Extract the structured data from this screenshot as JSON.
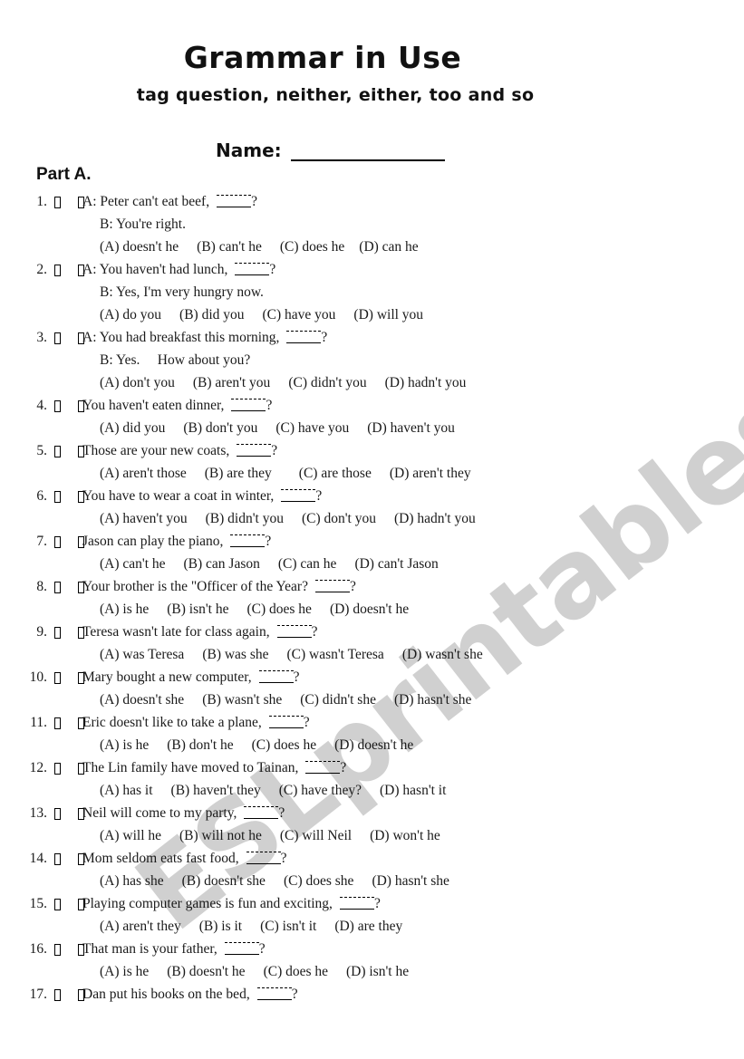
{
  "header": {
    "title": "Grammar in Use",
    "subtitle": "tag question, neither, either, too and so",
    "name_label": "Name:"
  },
  "part_label": "Part A.",
  "watermark": "ESLprintables.com",
  "questions": [
    {
      "num": "1.",
      "stem": "A: Peter can't eat beef,",
      "sub": "B: You're right.",
      "options": [
        "(A) doesn't he",
        "(B) can't he",
        "(C) does he",
        "(D) can he"
      ]
    },
    {
      "num": "2.",
      "stem": "A: You haven't had lunch,",
      "sub": "B: Yes, I'm very hungry now.",
      "options": [
        "(A) do you",
        "(B) did you",
        "(C) have you",
        "(D) will you"
      ]
    },
    {
      "num": "3.",
      "stem": "A: You had breakfast this morning,",
      "sub": "B: Yes.     How about you?",
      "options": [
        "(A) don't you",
        "(B) aren't you",
        "(C) didn't you",
        "(D) hadn't you"
      ]
    },
    {
      "num": "4.",
      "stem": "You haven't eaten dinner,",
      "options": [
        "(A) did you",
        "(B) don't you",
        "(C) have you",
        "(D) haven't you"
      ]
    },
    {
      "num": "5.",
      "stem": "Those are your new coats,",
      "options": [
        "(A) aren't those",
        "(B) are they",
        "(C) are those",
        "(D) aren't they"
      ]
    },
    {
      "num": "6.",
      "stem": "You have to wear a coat in winter,",
      "options": [
        "(A) haven't you",
        "(B) didn't you",
        "(C) don't you",
        "(D) hadn't you"
      ]
    },
    {
      "num": "7.",
      "stem": "Jason can play the piano,",
      "options": [
        "(A) can't he",
        "(B) can Jason",
        "(C) can he",
        "(D) can't Jason"
      ]
    },
    {
      "num": "8.",
      "stem": "Your brother is the \"Officer of the Year?",
      "options": [
        "(A) is he",
        "(B) isn't he",
        "(C) does he",
        "(D) doesn't he"
      ]
    },
    {
      "num": "9.",
      "stem": "Teresa wasn't late for class again,",
      "options": [
        "(A) was Teresa",
        "(B) was she",
        "(C) wasn't Teresa",
        "(D) wasn't she"
      ]
    },
    {
      "num": "10.",
      "stem": "Mary bought a new computer,",
      "options": [
        "(A) doesn't she",
        "(B) wasn't she",
        "(C) didn't she",
        "(D) hasn't she"
      ]
    },
    {
      "num": "11.",
      "stem": "Eric doesn't like to take a plane,",
      "options": [
        "(A) is he",
        "(B) don't he",
        "(C) does he",
        "(D) doesn't he"
      ]
    },
    {
      "num": "12.",
      "stem": "The Lin family have moved to Tainan,",
      "options": [
        "(A) has it",
        "(B) haven't they",
        "(C) have they?",
        "(D) hasn't it"
      ]
    },
    {
      "num": "13.",
      "stem": "Neil will come to my party,",
      "options": [
        "(A) will he",
        "(B) will not he",
        "(C) will Neil",
        "(D) won't he"
      ]
    },
    {
      "num": "14.",
      "stem": "Mom seldom eats fast food,",
      "options": [
        "(A) has she",
        "(B) doesn't she",
        "(C) does she",
        "(D) hasn't she"
      ]
    },
    {
      "num": "15.",
      "stem": "Playing computer games is fun and exciting,",
      "options": [
        "(A) aren't they",
        "(B) is it",
        "(C) isn't it",
        "(D) are they"
      ]
    },
    {
      "num": "16.",
      "stem": "That man is your father,",
      "options": [
        "(A) is he",
        "(B) doesn't he",
        "(C) does he",
        "(D) isn't he"
      ]
    },
    {
      "num": "17.",
      "stem": "Dan put his books on the bed,",
      "options": []
    }
  ],
  "question_mark": "?"
}
